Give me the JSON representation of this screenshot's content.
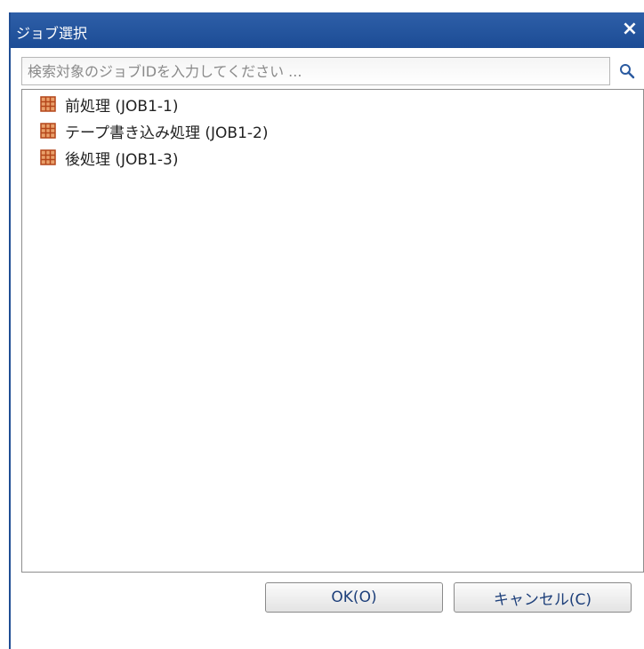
{
  "dialog": {
    "title": "ジョブ選択",
    "close_label": "×"
  },
  "search": {
    "value": "",
    "placeholder": "検索対象のジョブIDを入力してください ..."
  },
  "tree": {
    "items": [
      {
        "label": "前処理 (JOB1-1)",
        "icon": "job-icon"
      },
      {
        "label": "テープ書き込み処理 (JOB1-2)",
        "icon": "job-icon"
      },
      {
        "label": "後処理 (JOB1-3)",
        "icon": "job-icon"
      }
    ]
  },
  "buttons": {
    "ok_label": "OK(O)",
    "cancel_label": "キャンセル(C)"
  },
  "colors": {
    "titlebar": "#1c4c95",
    "job_icon": "#c0561f",
    "button_text": "#1d3f7a"
  }
}
